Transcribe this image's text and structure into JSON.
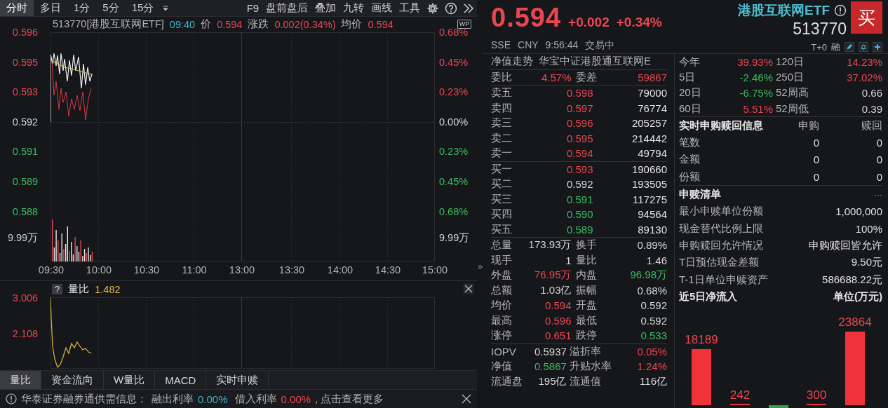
{
  "toolbar": {
    "periods": [
      {
        "label": "分时",
        "selected": true
      },
      {
        "label": "多日",
        "selected": false
      },
      {
        "label": "1分",
        "selected": false
      },
      {
        "label": "5分",
        "selected": false
      },
      {
        "label": "15分",
        "selected": false
      }
    ],
    "tools": [
      "F9",
      "盘前盘后",
      "叠加",
      "九转",
      "画线",
      "工具"
    ]
  },
  "quote_line": {
    "symbol": "513770[港股互联网ETF]",
    "time": "09:40",
    "price_label": "价",
    "price": "0.594",
    "change_label": "涨跌",
    "change": "0.002(0.34%)",
    "avg_label": "均价",
    "avg": "0.594",
    "wp": "WP"
  },
  "price_axis": {
    "left": [
      {
        "label": "0.596",
        "color": "#e8474f"
      },
      {
        "label": "0.595",
        "color": "#e8474f"
      },
      {
        "label": "0.593",
        "color": "#e8474f"
      },
      {
        "label": "0.592",
        "color": "#d6d6d6"
      },
      {
        "label": "0.591",
        "color": "#3dbb5e"
      },
      {
        "label": "0.589",
        "color": "#3dbb5e"
      },
      {
        "label": "0.588",
        "color": "#3dbb5e"
      }
    ],
    "right": [
      {
        "label": "0.68%",
        "color": "#e8474f"
      },
      {
        "label": "0.45%",
        "color": "#e8474f"
      },
      {
        "label": "0.23%",
        "color": "#e8474f"
      },
      {
        "label": "0.00%",
        "color": "#d6d6d6"
      },
      {
        "label": "0.23%",
        "color": "#3dbb5e"
      },
      {
        "label": "0.45%",
        "color": "#3dbb5e"
      },
      {
        "label": "0.68%",
        "color": "#3dbb5e"
      }
    ],
    "volume_left": "9.99万",
    "volume_right": "9.99万"
  },
  "time_axis": [
    "09:30",
    "10:00",
    "10:30",
    "11:00",
    "13:00",
    "13:30",
    "14:00",
    "14:30",
    "15:00"
  ],
  "indicator": {
    "help": "?",
    "name": "量比",
    "value": "1.482",
    "axis": [
      "3.006",
      "2.108"
    ]
  },
  "indicator_tabs": [
    {
      "label": "量比",
      "selected": true
    },
    {
      "label": "资金流向",
      "selected": false
    },
    {
      "label": "W量比",
      "selected": false
    },
    {
      "label": "MACD",
      "selected": false
    },
    {
      "label": "实时申赎",
      "selected": false
    }
  ],
  "notice": {
    "text": "华泰证券融券通供需信息：",
    "lend_label": "融出利率",
    "lend_rate": "0.00%",
    "borrow_label": "借入利率",
    "borrow_rate": "0.00%",
    "link": ", 点击查看更多"
  },
  "quote": {
    "price": "0.594",
    "change": "+0.002",
    "change_pct": "+0.34%",
    "color": "#e8474f",
    "name": "港股互联网ETF",
    "code": "513770",
    "buy": "买",
    "exchange": "SSE",
    "currency": "CNY",
    "time": "9:56:44",
    "status": "交易中",
    "t0": "T+0",
    "margin": "融"
  },
  "nav_row": {
    "label": "净值走势",
    "fund": "华宝中证港股通互联网E"
  },
  "order_ratio": [
    {
      "label": "委比",
      "value": "4.57%",
      "color": "#e8474f"
    },
    {
      "label": "委差",
      "value": "59867",
      "color": "#e8474f"
    }
  ],
  "asks": [
    {
      "label": "卖五",
      "price": "0.598",
      "color": "#e8474f",
      "volume": "79000"
    },
    {
      "label": "卖四",
      "price": "0.597",
      "color": "#e8474f",
      "volume": "76774"
    },
    {
      "label": "卖三",
      "price": "0.596",
      "color": "#e8474f",
      "volume": "205257"
    },
    {
      "label": "卖二",
      "price": "0.595",
      "color": "#e8474f",
      "volume": "214442"
    },
    {
      "label": "卖一",
      "price": "0.594",
      "color": "#e8474f",
      "volume": "49794"
    }
  ],
  "bids": [
    {
      "label": "买一",
      "price": "0.593",
      "color": "#e8474f",
      "volume": "190660"
    },
    {
      "label": "买二",
      "price": "0.592",
      "color": "#d6d6d6",
      "volume": "193505"
    },
    {
      "label": "买三",
      "price": "0.591",
      "color": "#3dbb5e",
      "volume": "117275"
    },
    {
      "label": "买四",
      "price": "0.590",
      "color": "#3dbb5e",
      "volume": "94564"
    },
    {
      "label": "买五",
      "price": "0.589",
      "color": "#3dbb5e",
      "volume": "89130"
    }
  ],
  "stats": [
    {
      "label": "总量",
      "value": "173.93万",
      "color": "#d6d6d6"
    },
    {
      "label": "换手",
      "value": "0.89%",
      "color": "#d6d6d6"
    },
    {
      "label": "现手",
      "value": "1",
      "color": "#d6d6d6"
    },
    {
      "label": "量比",
      "value": "1.46",
      "color": "#d6d6d6"
    },
    {
      "label": "外盘",
      "value": "76.95万",
      "color": "#e8474f"
    },
    {
      "label": "内盘",
      "value": "96.98万",
      "color": "#3dbb5e"
    },
    {
      "label": "总额",
      "value": "1.03亿",
      "color": "#d6d6d6"
    },
    {
      "label": "振幅",
      "value": "0.68%",
      "color": "#d6d6d6"
    },
    {
      "label": "均价",
      "value": "0.594",
      "color": "#e8474f"
    },
    {
      "label": "开盘",
      "value": "0.592",
      "color": "#d6d6d6"
    },
    {
      "label": "最高",
      "value": "0.596",
      "color": "#e8474f"
    },
    {
      "label": "最低",
      "value": "0.592",
      "color": "#d6d6d6"
    },
    {
      "label": "涨停",
      "value": "0.651",
      "color": "#e8474f"
    },
    {
      "label": "跌停",
      "value": "0.533",
      "color": "#3dbb5e"
    }
  ],
  "nav_stats": [
    {
      "label": "IOPV",
      "value": "0.5937",
      "color": "#d6d6d6"
    },
    {
      "label": "溢折率",
      "value": "0.05%",
      "color": "#e8474f"
    },
    {
      "label": "净值",
      "value": "0.5867",
      "color": "#3dbb5e"
    },
    {
      "label": "升贴水率",
      "value": "1.24%",
      "color": "#e8474f"
    },
    {
      "label": "流通盘",
      "value": "195亿",
      "color": "#d6d6d6"
    },
    {
      "label": "流通值",
      "value": "116亿",
      "color": "#d6d6d6"
    }
  ],
  "performance": [
    {
      "label": "今年",
      "value": "39.93%",
      "color": "#e8474f"
    },
    {
      "label": "120日",
      "value": "14.23%",
      "color": "#e8474f"
    },
    {
      "label": "5日",
      "value": "-2.46%",
      "color": "#3dbb5e"
    },
    {
      "label": "250日",
      "value": "37.02%",
      "color": "#e8474f"
    },
    {
      "label": "20日",
      "value": "-6.75%",
      "color": "#3dbb5e"
    },
    {
      "label": "52周高",
      "value": "0.66",
      "color": "#d6d6d6"
    },
    {
      "label": "60日",
      "value": "5.51%",
      "color": "#e8474f"
    },
    {
      "label": "52周低",
      "value": "0.39",
      "color": "#d6d6d6"
    }
  ],
  "creation": {
    "title": "实时申购赎回信息",
    "columns": [
      "申购",
      "赎回"
    ],
    "rows": [
      {
        "label": "笔数",
        "values": [
          "0",
          "0"
        ]
      },
      {
        "label": "金额",
        "values": [
          "0",
          "0"
        ]
      },
      {
        "label": "份额",
        "values": [
          "0",
          "0"
        ]
      }
    ]
  },
  "basket": {
    "title": "申赎清单",
    "more": "···",
    "rows": [
      {
        "label": "最小申赎单位份额",
        "value": "1,000,000"
      },
      {
        "label": "现金替代比例上限",
        "value": "100%"
      },
      {
        "label": "申购赎回允许情况",
        "value": "申购赎回皆允许"
      },
      {
        "label": "T日预估现金差额",
        "value": "9.50元"
      },
      {
        "label": "T-1日单位申赎资产",
        "value": "586688.22元"
      }
    ]
  },
  "net_inflow": {
    "title": "近5日净流入",
    "unit": "单位(万元)",
    "bars": [
      {
        "kind": "inflow",
        "label": "18189"
      },
      {
        "kind": "inflow",
        "label": "242"
      },
      {
        "kind": "outflow"
      },
      {
        "kind": "inflow",
        "label": "300"
      },
      {
        "kind": "inflow",
        "label": "23864"
      }
    ]
  }
}
